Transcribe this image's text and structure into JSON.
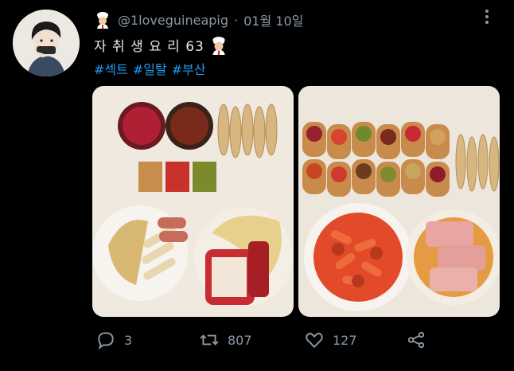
{
  "tweet": {
    "handle": "@1loveguineapig",
    "separator": "·",
    "date": "01월 10일",
    "text": "자 취 생 요 리 63",
    "hashtags": [
      "#섹트",
      "#일탈",
      "#부산"
    ],
    "emoji": "chef-emoji"
  },
  "photos": [
    {
      "label": "photo-ingredients"
    },
    {
      "label": "photo-cooked-meal"
    }
  ],
  "actions": {
    "reply_count": "3",
    "retweet_count": "807",
    "like_count": "127"
  },
  "colors": {
    "background": "#000000",
    "text": "#e7e9ea",
    "secondary": "#8b98a5",
    "hashtag": "#1d9bf0"
  }
}
